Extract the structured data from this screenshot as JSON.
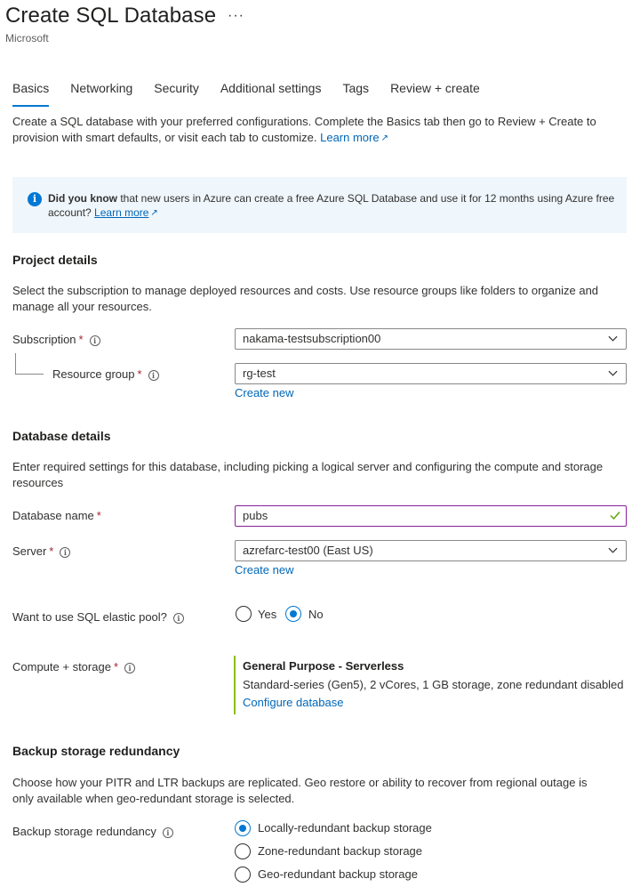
{
  "header": {
    "title": "Create SQL Database",
    "more": "···",
    "publisher": "Microsoft"
  },
  "tabs": [
    {
      "label": "Basics",
      "active": true
    },
    {
      "label": "Networking",
      "active": false
    },
    {
      "label": "Security",
      "active": false
    },
    {
      "label": "Additional settings",
      "active": false
    },
    {
      "label": "Tags",
      "active": false
    },
    {
      "label": "Review + create",
      "active": false
    }
  ],
  "intro": {
    "text": "Create a SQL database with your preferred configurations. Complete the Basics tab then go to Review + Create to provision with smart defaults, or visit each tab to customize.",
    "learn_more": "Learn more"
  },
  "info_banner": {
    "bold": "Did you know",
    "text": " that new users in Azure can create a free Azure SQL Database and use it for 12 months using Azure free account?",
    "learn_more": "Learn more"
  },
  "project_details": {
    "heading": "Project details",
    "description": "Select the subscription to manage deployed resources and costs. Use resource groups like folders to organize and manage all your resources.",
    "subscription": {
      "label": "Subscription",
      "value": "nakama-testsubscription00"
    },
    "resource_group": {
      "label": "Resource group",
      "value": "rg-test",
      "create_new": "Create new"
    }
  },
  "database_details": {
    "heading": "Database details",
    "description": "Enter required settings for this database, including picking a logical server and configuring the compute and storage resources",
    "database_name": {
      "label": "Database name",
      "value": "pubs"
    },
    "server": {
      "label": "Server",
      "value": "azrefarc-test00 (East US)",
      "create_new": "Create new"
    },
    "elastic_pool": {
      "label": "Want to use SQL elastic pool?",
      "yes": "Yes",
      "no": "No",
      "selected": "No"
    },
    "compute": {
      "label": "Compute + storage",
      "title": "General Purpose - Serverless",
      "description": "Standard-series (Gen5), 2 vCores, 1 GB storage, zone redundant disabled",
      "link": "Configure database"
    }
  },
  "backup": {
    "heading": "Backup storage redundancy",
    "description": "Choose how your PITR and LTR backups are replicated. Geo restore or ability to recover from regional outage is only available when geo-redundant storage is selected.",
    "label": "Backup storage redundancy",
    "options": [
      {
        "label": "Locally-redundant backup storage",
        "selected": true
      },
      {
        "label": "Zone-redundant backup storage",
        "selected": false
      },
      {
        "label": "Geo-redundant backup storage",
        "selected": false
      }
    ]
  },
  "required_marker": "*",
  "colors": {
    "accent": "#0078d4",
    "link": "#0067b8",
    "info_bg": "#eff6fc",
    "required": "#a4262c",
    "valid": "#57a300",
    "compute_bar": "#8cbd18"
  }
}
